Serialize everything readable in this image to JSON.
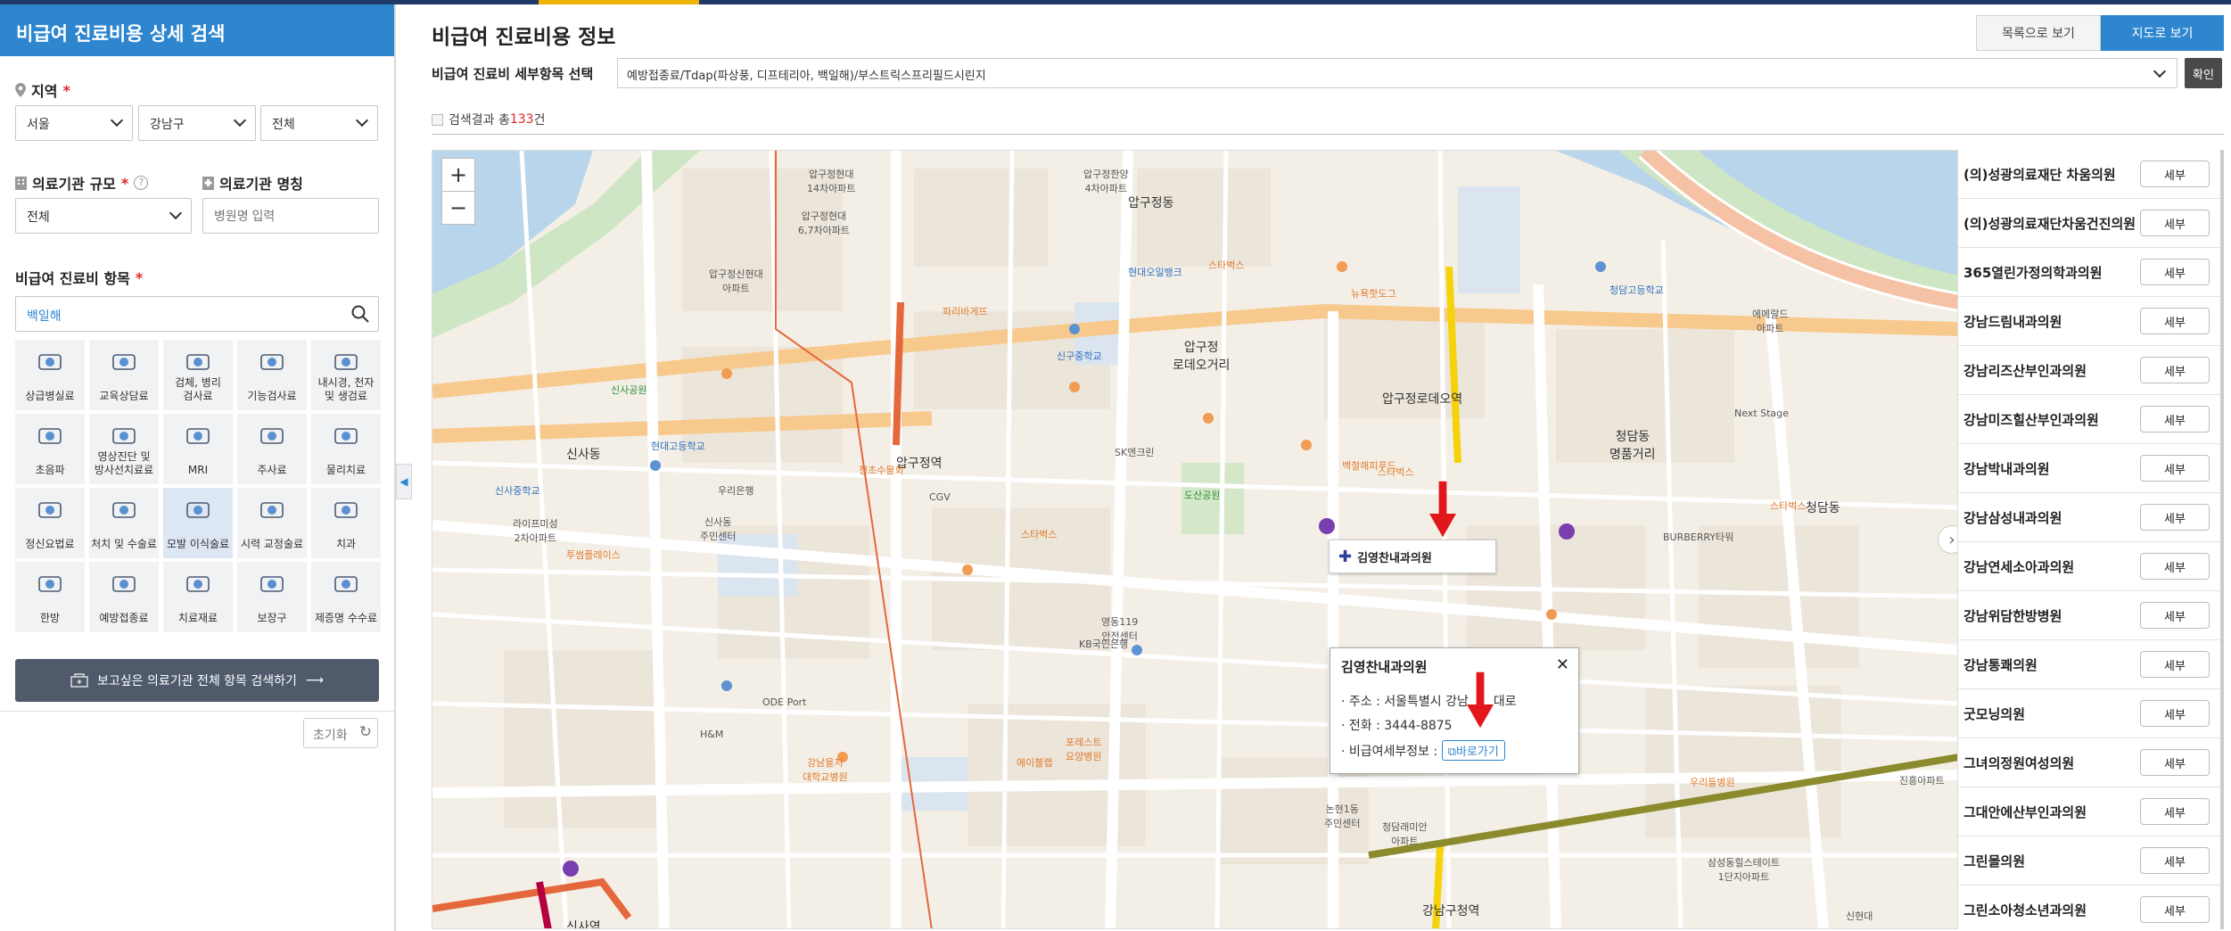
{
  "sidebar": {
    "header": "비급여 진료비용 상세 검색",
    "region_label": "지역",
    "region": {
      "sido": "서울",
      "sigungu": "강남구",
      "dong": "전체"
    },
    "scale_label": "의료기관 규모",
    "scale_value": "전체",
    "name_label": "의료기관 명칭",
    "name_placeholder": "병원명 입력",
    "item_label": "비급여 진료비 항목",
    "item_search_value": "백일해",
    "categories": [
      {
        "label": "상급병실료",
        "icon": "bed-icon"
      },
      {
        "label": "교육상담료",
        "icon": "consult-icon"
      },
      {
        "label": "검체, 병리\n검사료",
        "icon": "test-tube-icon"
      },
      {
        "label": "기능검사료",
        "icon": "function-test-icon"
      },
      {
        "label": "내시경, 천자\n및 생검료",
        "icon": "endoscope-icon"
      },
      {
        "label": "초음파",
        "icon": "ultrasound-icon"
      },
      {
        "label": "영상진단 및\n방사선치료료",
        "icon": "xray-icon"
      },
      {
        "label": "MRI",
        "icon": "mri-icon"
      },
      {
        "label": "주사료",
        "icon": "injection-icon"
      },
      {
        "label": "물리치료",
        "icon": "physio-icon"
      },
      {
        "label": "정신요법료",
        "icon": "brain-icon"
      },
      {
        "label": "처치 및 수술료",
        "icon": "surgery-icon"
      },
      {
        "label": "모발 이식술료",
        "icon": "hair-icon"
      },
      {
        "label": "시력 교정술료",
        "icon": "eye-icon"
      },
      {
        "label": "치과",
        "icon": "tooth-icon"
      },
      {
        "label": "한방",
        "icon": "ear-icon"
      },
      {
        "label": "예방접종료",
        "icon": "vaccine-icon"
      },
      {
        "label": "치료재료",
        "icon": "material-icon"
      },
      {
        "label": "보장구",
        "icon": "wheelchair-icon"
      },
      {
        "label": "제증명 수수료",
        "icon": "certificate-icon"
      }
    ],
    "search_all_button": "보고싶은 의료기관 전체 항목 검색하기",
    "reset_button": "초기화"
  },
  "main": {
    "title": "비급여 진료비용 정보",
    "list_view_button": "목록으로 보기",
    "map_view_button": "지도로 보기",
    "detail_label": "비급여 진료비 세부항목 선택",
    "detail_value": "예방접종료/Tdap(파상풍, 디프테리아, 백일해)/부스트릭스프리필드시린지",
    "confirm_button": "확인",
    "result_prefix": "검색결과 총",
    "result_count": "133",
    "result_suffix": "건"
  },
  "map": {
    "zoom_in": "+",
    "zoom_out": "−",
    "marker_label": "김영찬내과의원",
    "popup": {
      "title": "김영찬내과의원",
      "address": "· 주소 : 서울특별시 강남",
      "address_tail": "대로",
      "phone": "· 전화 : 3444-8875",
      "info_label": "· 비급여세부정보 :",
      "go_button": "바로가기"
    },
    "labels": [
      {
        "t": "압구정동",
        "c": "big"
      },
      {
        "t": "신사동",
        "c": "big"
      },
      {
        "t": "압구정\n로데오거리",
        "c": "big"
      },
      {
        "t": "청담동\n명품거리",
        "c": "big"
      },
      {
        "t": "청담동",
        "c": "big"
      },
      {
        "t": "압구정역",
        "c": "big"
      },
      {
        "t": "압구정로데오역",
        "c": "big"
      },
      {
        "t": "신사역",
        "c": "big"
      },
      {
        "t": "강남구청역",
        "c": "big"
      },
      {
        "t": "도산공원",
        "c": "g"
      },
      {
        "t": "신사공원",
        "c": "g"
      },
      {
        "t": "현대오일뱅크",
        "c": "b"
      },
      {
        "t": "신구중학교",
        "c": "b"
      },
      {
        "t": "청담고등학교",
        "c": "b"
      },
      {
        "t": "신사중학교",
        "c": "b"
      },
      {
        "t": "현대고등학교",
        "c": "b"
      },
      {
        "t": "스타벅스",
        "c": "o"
      },
      {
        "t": "스타벅스",
        "c": "o"
      },
      {
        "t": "스타벅스",
        "c": "o"
      },
      {
        "t": "스타벅스",
        "c": "o"
      },
      {
        "t": "파리바게뜨",
        "c": "o"
      },
      {
        "t": "뉴욕핫도그",
        "c": "o"
      },
      {
        "t": "청초수물회",
        "c": "o"
      },
      {
        "t": "투썸플레이스",
        "c": "o"
      },
      {
        "t": "백철해피푸드",
        "c": "o"
      },
      {
        "t": "포레스트\n요양병원",
        "c": "o"
      },
      {
        "t": "압구정한양\n4차아파트",
        "c": ""
      },
      {
        "t": "압구정현대\n14차아파트",
        "c": ""
      },
      {
        "t": "압구정현대\n6,7차아파트",
        "c": ""
      },
      {
        "t": "압구정신현대\n아파트",
        "c": ""
      },
      {
        "t": "라이프미성\n2차아파트",
        "c": ""
      },
      {
        "t": "신사동\n주민센터",
        "c": ""
      },
      {
        "t": "우리은행",
        "c": ""
      },
      {
        "t": "SK엔크린",
        "c": ""
      },
      {
        "t": "CGV",
        "c": ""
      },
      {
        "t": "KB국민은행",
        "c": ""
      },
      {
        "t": "BURBERRY타워",
        "c": ""
      },
      {
        "t": "Next Stage",
        "c": ""
      },
      {
        "t": "영동119\n안전센터",
        "c": ""
      },
      {
        "t": "ODE Port",
        "c": ""
      },
      {
        "t": "H&M",
        "c": ""
      },
      {
        "t": "논현1동\n주민센터",
        "c": ""
      },
      {
        "t": "청담래미안\n아파트",
        "c": ""
      },
      {
        "t": "강남을지\n대학교병원",
        "c": "o"
      },
      {
        "t": "에이블랩",
        "c": "o"
      },
      {
        "t": "우리들병원",
        "c": "o"
      },
      {
        "t": "진흥아파트",
        "c": ""
      },
      {
        "t": "에메랄드\n아파트",
        "c": ""
      },
      {
        "t": "삼성동힐스테이트\n1단지아파트",
        "c": ""
      },
      {
        "t": "신현대",
        "c": ""
      }
    ]
  },
  "list": {
    "detail_button": "세부",
    "items": [
      "(의)성광의료재단 차움의원",
      "(의)성광의료재단차움건진의원",
      "365열린가정의학과의원",
      "강남드림내과의원",
      "강남리즈산부인과의원",
      "강남미즈힐산부인과의원",
      "강남박내과의원",
      "강남삼성내과의원",
      "강남연세소아과의원",
      "강남위담한방병원",
      "강남통쾌의원",
      "굿모닝의원",
      "그녀의정원여성의원",
      "그대안에산부인과의원",
      "그린몰의원",
      "그린소아청소년과의원"
    ]
  },
  "colors": {
    "accent": "#2e86cf",
    "dark_button": "#4f5a6b",
    "required": "#e0262b",
    "arrow": "#e2161b"
  }
}
